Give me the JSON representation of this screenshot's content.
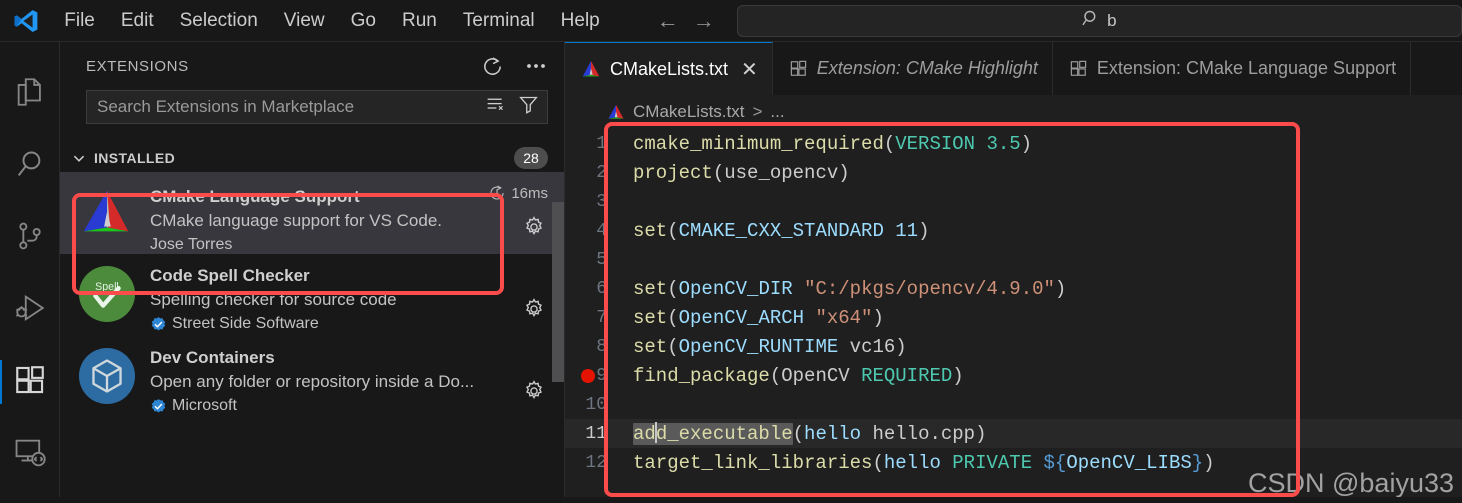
{
  "titlebar": {
    "logo_icon": "vscode-logo",
    "menus": [
      "File",
      "Edit",
      "Selection",
      "View",
      "Go",
      "Run",
      "Terminal",
      "Help"
    ],
    "back_icon": "arrow-left-icon",
    "forward_icon": "arrow-right-icon",
    "command_center": {
      "search_icon": "search-icon",
      "value": "b"
    }
  },
  "activitybar": {
    "items": [
      {
        "name": "explorer",
        "icon": "files-icon",
        "active": false
      },
      {
        "name": "search",
        "icon": "search-icon",
        "active": false
      },
      {
        "name": "source-control",
        "icon": "source-control-icon",
        "active": false
      },
      {
        "name": "run-and-debug",
        "icon": "run-debug-icon",
        "active": false
      },
      {
        "name": "extensions",
        "icon": "extensions-icon",
        "active": true
      },
      {
        "name": "remote-explorer",
        "icon": "remote-explorer-icon",
        "active": false
      }
    ]
  },
  "sidebar": {
    "title": "EXTENSIONS",
    "refresh_icon": "refresh-icon",
    "more_icon": "more-actions-icon",
    "search": {
      "placeholder": "Search Extensions in Marketplace",
      "value": "",
      "clear_icon": "clear-filter-icon",
      "filter_icon": "filter-icon"
    },
    "section": {
      "chevron_icon": "chevron-down-icon",
      "label": "INSTALLED",
      "count": "28"
    },
    "extensions": [
      {
        "name": "CMake Language Support",
        "description": "CMake language support for VS Code.",
        "publisher": "Jose Torres",
        "verified": false,
        "activation": "16ms",
        "activation_icon": "stopwatch-icon",
        "icon": "cmake-logo-icon",
        "gear_icon": "gear-icon",
        "selected": true
      },
      {
        "name": "Code Spell Checker",
        "description": "Spelling checker for source code",
        "publisher": "Street Side Software",
        "verified": true,
        "activation": "",
        "activation_icon": "",
        "icon": "spell-check-icon",
        "gear_icon": "gear-icon",
        "selected": false
      },
      {
        "name": "Dev Containers",
        "description": "Open any folder or repository inside a Do...",
        "publisher": "Microsoft",
        "verified": true,
        "activation": "",
        "activation_icon": "",
        "icon": "dev-containers-icon",
        "gear_icon": "gear-icon",
        "selected": false
      }
    ]
  },
  "editor": {
    "tabs": [
      {
        "label": "CMakeLists.txt",
        "icon": "cmake-file-icon",
        "active": true,
        "preview": false,
        "close_icon": "close-icon"
      },
      {
        "label": "Extension: CMake Highlight",
        "icon": "extensions-icon",
        "active": false,
        "preview": true,
        "close_icon": ""
      },
      {
        "label": "Extension: CMake Language Support",
        "icon": "extensions-icon",
        "active": false,
        "preview": false,
        "close_icon": ""
      }
    ],
    "breadcrumb": {
      "icon": "cmake-file-icon",
      "file": "CMakeLists.txt",
      "separator": ">",
      "tail": "..."
    },
    "watermark": "CSDN @baiyu33",
    "breakpoint_line": 9,
    "current_line": 11,
    "lines": [
      {
        "n": "1",
        "tokens": [
          {
            "t": "fn",
            "v": "cmake_minimum_required"
          },
          {
            "t": "punct",
            "v": "("
          },
          {
            "t": "kw",
            "v": "VERSION 3.5"
          },
          {
            "t": "punct",
            "v": ")"
          }
        ]
      },
      {
        "n": "2",
        "tokens": [
          {
            "t": "fn",
            "v": "project"
          },
          {
            "t": "punct",
            "v": "("
          },
          {
            "t": "plain",
            "v": "use_opencv"
          },
          {
            "t": "punct",
            "v": ")"
          }
        ]
      },
      {
        "n": "3",
        "tokens": []
      },
      {
        "n": "4",
        "tokens": [
          {
            "t": "fn",
            "v": "set"
          },
          {
            "t": "punct",
            "v": "("
          },
          {
            "t": "var",
            "v": "CMAKE_CXX_STANDARD"
          },
          {
            "t": "plain",
            "v": " "
          },
          {
            "t": "var",
            "v": "11"
          },
          {
            "t": "punct",
            "v": ")"
          }
        ]
      },
      {
        "n": "5",
        "tokens": []
      },
      {
        "n": "6",
        "tokens": [
          {
            "t": "fn",
            "v": "set"
          },
          {
            "t": "punct",
            "v": "("
          },
          {
            "t": "var",
            "v": "OpenCV_DIR"
          },
          {
            "t": "plain",
            "v": " "
          },
          {
            "t": "str",
            "v": "\"C:/pkgs/opencv/4.9.0\""
          },
          {
            "t": "punct",
            "v": ")"
          }
        ]
      },
      {
        "n": "7",
        "tokens": [
          {
            "t": "fn",
            "v": "set"
          },
          {
            "t": "punct",
            "v": "("
          },
          {
            "t": "var",
            "v": "OpenCV_ARCH"
          },
          {
            "t": "plain",
            "v": " "
          },
          {
            "t": "str",
            "v": "\"x64\""
          },
          {
            "t": "punct",
            "v": ")"
          }
        ]
      },
      {
        "n": "8",
        "tokens": [
          {
            "t": "fn",
            "v": "set"
          },
          {
            "t": "punct",
            "v": "("
          },
          {
            "t": "var",
            "v": "OpenCV_RUNTIME"
          },
          {
            "t": "plain",
            "v": " "
          },
          {
            "t": "plain",
            "v": "vc16"
          },
          {
            "t": "punct",
            "v": ")"
          }
        ]
      },
      {
        "n": "9",
        "tokens": [
          {
            "t": "fn",
            "v": "find_package"
          },
          {
            "t": "punct",
            "v": "("
          },
          {
            "t": "plain",
            "v": "OpenCV "
          },
          {
            "t": "kw",
            "v": "REQUIRED"
          },
          {
            "t": "punct",
            "v": ")"
          }
        ]
      },
      {
        "n": "10",
        "tokens": []
      },
      {
        "n": "11",
        "tokens": [
          {
            "t": "fn",
            "v": "add_executable",
            "hl": true,
            "caret": 2
          },
          {
            "t": "punct",
            "v": "("
          },
          {
            "t": "var",
            "v": "hello"
          },
          {
            "t": "plain",
            "v": " hello.cpp"
          },
          {
            "t": "punct",
            "v": ")"
          }
        ]
      },
      {
        "n": "12",
        "tokens": [
          {
            "t": "fn",
            "v": "target_link_libraries"
          },
          {
            "t": "punct",
            "v": "("
          },
          {
            "t": "var",
            "v": "hello"
          },
          {
            "t": "plain",
            "v": " "
          },
          {
            "t": "kw",
            "v": "PRIVATE"
          },
          {
            "t": "plain",
            "v": " "
          },
          {
            "t": "dollar",
            "v": "${"
          },
          {
            "t": "var",
            "v": "OpenCV_LIBS"
          },
          {
            "t": "dollar",
            "v": "}"
          },
          {
            "t": "punct",
            "v": ")"
          }
        ]
      }
    ]
  },
  "colors": {
    "accent": "#0078d4",
    "annotation": "#fb4b4b",
    "breakpoint": "#e51400",
    "editor_bg": "#1f1f1f",
    "sidebar_bg": "#181818",
    "selection_bg": "#37373d"
  }
}
